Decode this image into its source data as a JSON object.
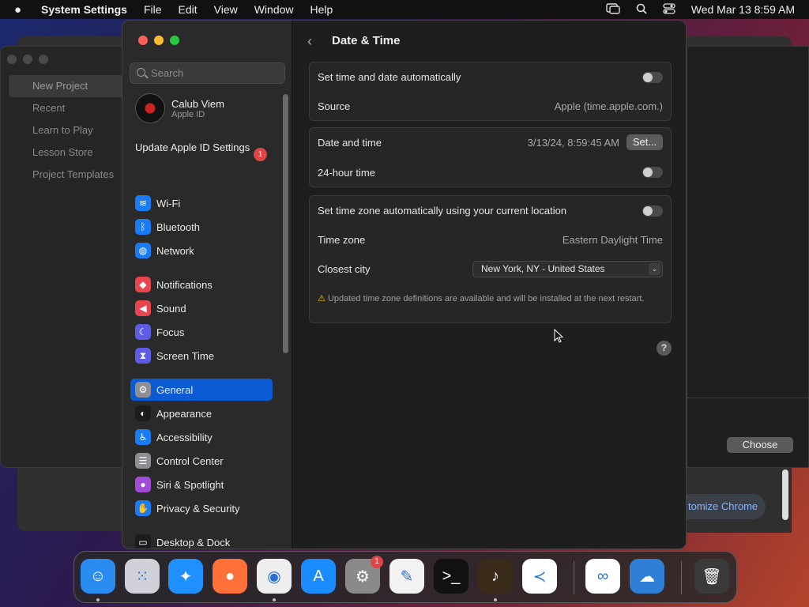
{
  "menubar": {
    "app": "System Settings",
    "items": [
      "File",
      "Edit",
      "View",
      "Window",
      "Help"
    ],
    "clock": "Wed Mar 13  8:59 AM"
  },
  "background": {
    "project_items": [
      "New Project",
      "Recent",
      "Learn to Play",
      "Lesson Store",
      "Project Templates"
    ],
    "choose_label": "Choose",
    "customize_label": "tomize Chrome"
  },
  "sidebar": {
    "search_placeholder": "Search",
    "profile_name": "Calub Viem",
    "profile_sub": "Apple ID",
    "update_label": "Update Apple ID Settings",
    "update_badge": "1",
    "items": [
      {
        "label": "Wi-Fi",
        "icon": "wifi-icon",
        "color": "#1a7cf5",
        "glyph": "≋"
      },
      {
        "label": "Bluetooth",
        "icon": "bluetooth-icon",
        "color": "#1a7cf5",
        "glyph": "ᛒ"
      },
      {
        "label": "Network",
        "icon": "globe-icon",
        "color": "#1a7cf5",
        "glyph": "◍"
      },
      {
        "label": "Notifications",
        "icon": "bell-icon",
        "color": "#e8454f",
        "glyph": "◆"
      },
      {
        "label": "Sound",
        "icon": "speaker-icon",
        "color": "#e8454f",
        "glyph": "◀"
      },
      {
        "label": "Focus",
        "icon": "moon-icon",
        "color": "#5e5ce6",
        "glyph": "☾"
      },
      {
        "label": "Screen Time",
        "icon": "hourglass-icon",
        "color": "#5e5ce6",
        "glyph": "⧗"
      },
      {
        "label": "General",
        "icon": "gear-icon",
        "color": "#8e8e93",
        "glyph": "⚙"
      },
      {
        "label": "Appearance",
        "icon": "appearance-icon",
        "color": "#1c1c1e",
        "glyph": "◐"
      },
      {
        "label": "Accessibility",
        "icon": "accessibility-icon",
        "color": "#1a7cf5",
        "glyph": "♿"
      },
      {
        "label": "Control Center",
        "icon": "switches-icon",
        "color": "#8e8e93",
        "glyph": "☰"
      },
      {
        "label": "Siri & Spotlight",
        "icon": "siri-icon",
        "color": "#a14bd6",
        "glyph": "●"
      },
      {
        "label": "Privacy & Security",
        "icon": "hand-icon",
        "color": "#1a7cf5",
        "glyph": "✋"
      },
      {
        "label": "Desktop & Dock",
        "icon": "dock-icon",
        "color": "#1c1c1e",
        "glyph": "▭"
      }
    ]
  },
  "main": {
    "title": "Date & Time",
    "group1": {
      "auto_label": "Set time and date automatically",
      "source_label": "Source",
      "source_value": "Apple (time.apple.com.)"
    },
    "group2": {
      "datetime_label": "Date and time",
      "datetime_value": "3/13/24, 8:59:45 AM",
      "set_label": "Set...",
      "hour24_label": "24-hour time"
    },
    "group3": {
      "tz_auto_label": "Set time zone automatically using your current location",
      "tz_label": "Time zone",
      "tz_value": "Eastern Daylight Time",
      "city_label": "Closest city",
      "city_value": "New York, NY - United States",
      "warning": "Updated time zone definitions are available and will be installed at the next restart."
    },
    "help": "?"
  },
  "dock": {
    "apps": [
      {
        "name": "finder-icon",
        "color": "#2a8cf0",
        "glyph": "☺"
      },
      {
        "name": "launchpad-icon",
        "color": "#d0d0d8",
        "glyph": "⁙"
      },
      {
        "name": "safari-icon",
        "color": "#1e90ff",
        "glyph": "✦"
      },
      {
        "name": "firefox-icon",
        "color": "#ff7139",
        "glyph": "●"
      },
      {
        "name": "chrome-icon",
        "color": "#eeeeee",
        "glyph": "◉"
      },
      {
        "name": "app-store-icon",
        "color": "#1a8cff",
        "glyph": "A"
      },
      {
        "name": "system-settings-icon",
        "color": "#8a8a8a",
        "glyph": "⚙"
      },
      {
        "name": "textedit-icon",
        "color": "#f2f2f2",
        "glyph": "✎"
      },
      {
        "name": "terminal-icon",
        "color": "#111111",
        "glyph": ">_"
      },
      {
        "name": "garageband-icon",
        "color": "#3a2a1a",
        "glyph": "♪"
      },
      {
        "name": "vscode-icon",
        "color": "#ffffff",
        "glyph": "≺"
      },
      {
        "name": "visual-studio-icon",
        "color": "#ffffff",
        "glyph": "∞"
      },
      {
        "name": "weather-icon",
        "color": "#2f7fd6",
        "glyph": "☁"
      },
      {
        "name": "trash-icon",
        "color": "#3a3a3a",
        "glyph": "🗑"
      }
    ],
    "settings_badge": "1"
  }
}
